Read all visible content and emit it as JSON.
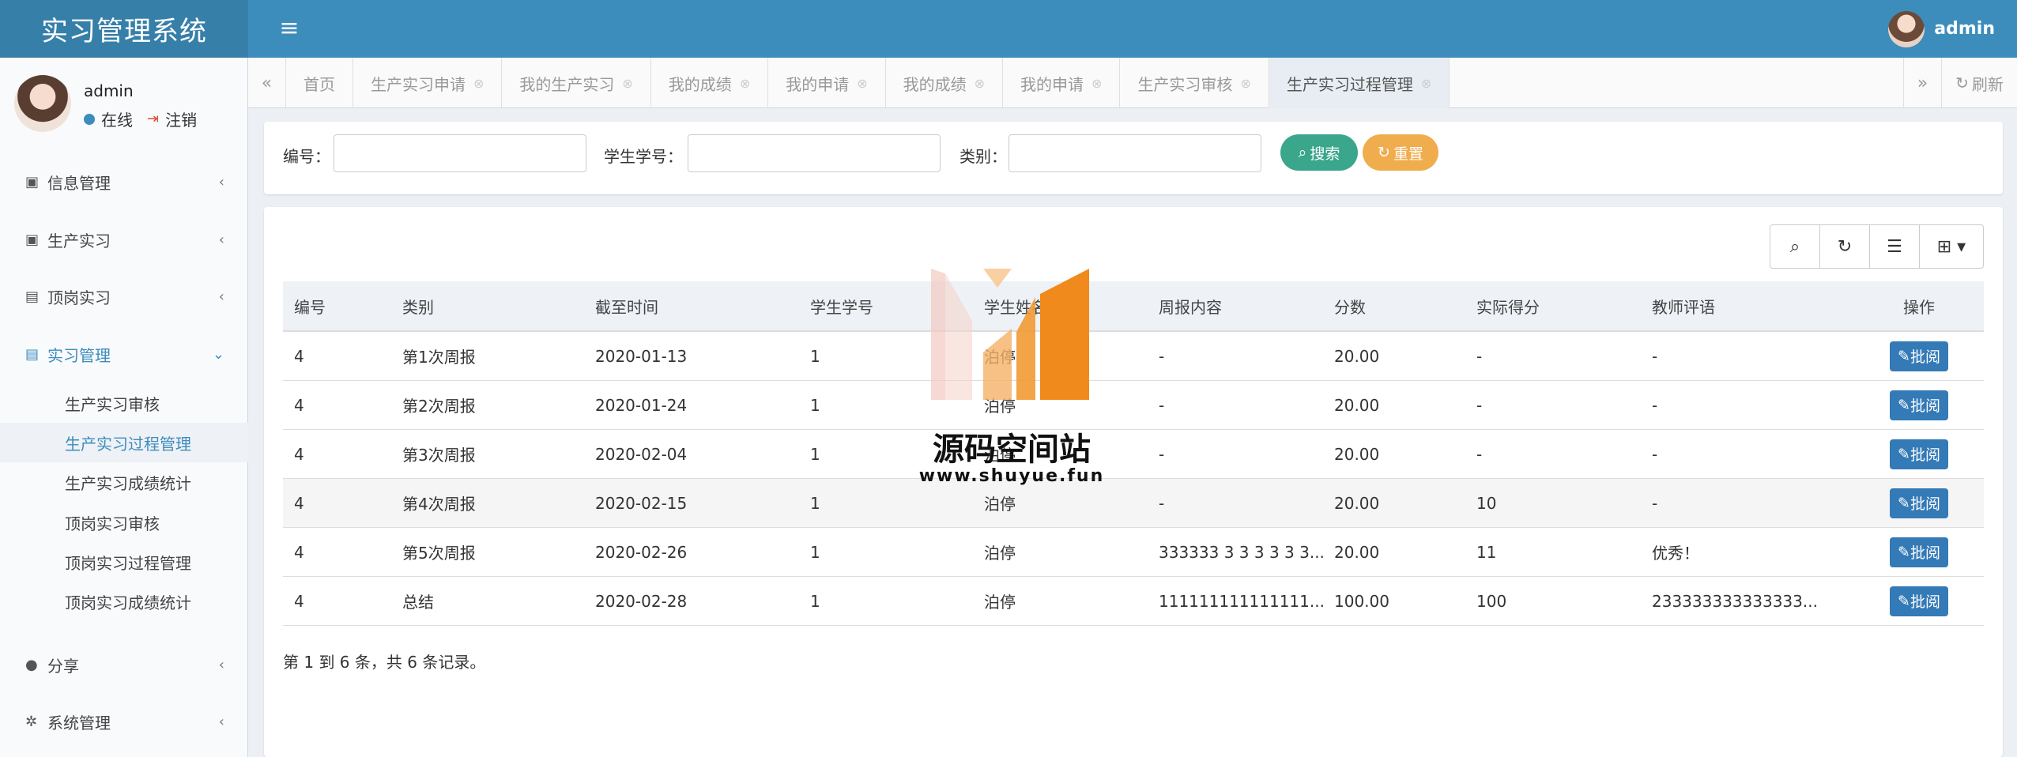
{
  "app": {
    "title": "实习管理系统",
    "menu_icon": "hamburger-icon"
  },
  "header": {
    "username": "admin"
  },
  "sidebar": {
    "user": {
      "name": "admin",
      "status": "在线",
      "logout": "注销"
    },
    "menu": [
      {
        "label": "信息管理",
        "icon": "id-card-icon"
      },
      {
        "label": "生产实习",
        "icon": "badge-icon"
      },
      {
        "label": "顶岗实习",
        "icon": "address-card-icon"
      },
      {
        "label": "实习管理",
        "icon": "id-card-icon",
        "active": true
      },
      {
        "label": "分享",
        "icon": "comment-icon"
      },
      {
        "label": "系统管理",
        "icon": "gear-icon"
      }
    ],
    "submenu": [
      {
        "label": "生产实习审核"
      },
      {
        "label": "生产实习过程管理",
        "active": true
      },
      {
        "label": "生产实习成绩统计"
      },
      {
        "label": "顶岗实习审核"
      },
      {
        "label": "顶岗实习过程管理"
      },
      {
        "label": "顶岗实习成绩统计"
      }
    ]
  },
  "tabs": {
    "items": [
      "首页",
      "生产实习申请",
      "我的生产实习",
      "我的成绩",
      "我的申请",
      "我的成绩",
      "我的申请",
      "生产实习审核",
      "生产实习过程管理"
    ],
    "active_index": 8,
    "refresh_label": "刷新"
  },
  "search": {
    "fields": [
      {
        "label": "编号：",
        "value": ""
      },
      {
        "label": "学生学号：",
        "value": ""
      },
      {
        "label": "类别：",
        "value": ""
      }
    ],
    "search_label": "搜索",
    "reset_label": "重置"
  },
  "table": {
    "columns": [
      "编号",
      "类别",
      "截至时间",
      "学生学号",
      "学生姓名",
      "周报内容",
      "分数",
      "实际得分",
      "教师评语",
      "操作"
    ],
    "rows": [
      [
        "4",
        "第1次周报",
        "2020-01-13",
        "1",
        "泊停",
        "-",
        "20.00",
        "-",
        "-"
      ],
      [
        "4",
        "第2次周报",
        "2020-01-24",
        "1",
        "泊停",
        "-",
        "20.00",
        "-",
        "-"
      ],
      [
        "4",
        "第3次周报",
        "2020-02-04",
        "1",
        "泊停",
        "-",
        "20.00",
        "-",
        "-"
      ],
      [
        "4",
        "第4次周报",
        "2020-02-15",
        "1",
        "泊停",
        "-",
        "20.00",
        "10",
        "-"
      ],
      [
        "4",
        "第5次周报",
        "2020-02-26",
        "1",
        "泊停",
        "333333 3 3 3 3 3 3...",
        "20.00",
        "11",
        "优秀！"
      ],
      [
        "4",
        "总结",
        "2020-02-28",
        "1",
        "泊停",
        "111111111111111...",
        "100.00",
        "100",
        "233333333333333..."
      ]
    ],
    "action_label": "批阅",
    "highlight_row": 3,
    "pagination": "第 1 到 6 条，共 6 条记录。"
  },
  "toolbar_icons": [
    "search-icon",
    "refresh-icon",
    "list-icon",
    "grid-icon"
  ],
  "watermark": {
    "title": "源码空间站",
    "url": "www.shuyue.fun"
  },
  "colors": {
    "header": "#3c8dbc",
    "logo": "#367fa9",
    "search_btn": "#3aa68c",
    "reset_btn": "#f0ad4e",
    "review_btn": "#337ab7"
  }
}
